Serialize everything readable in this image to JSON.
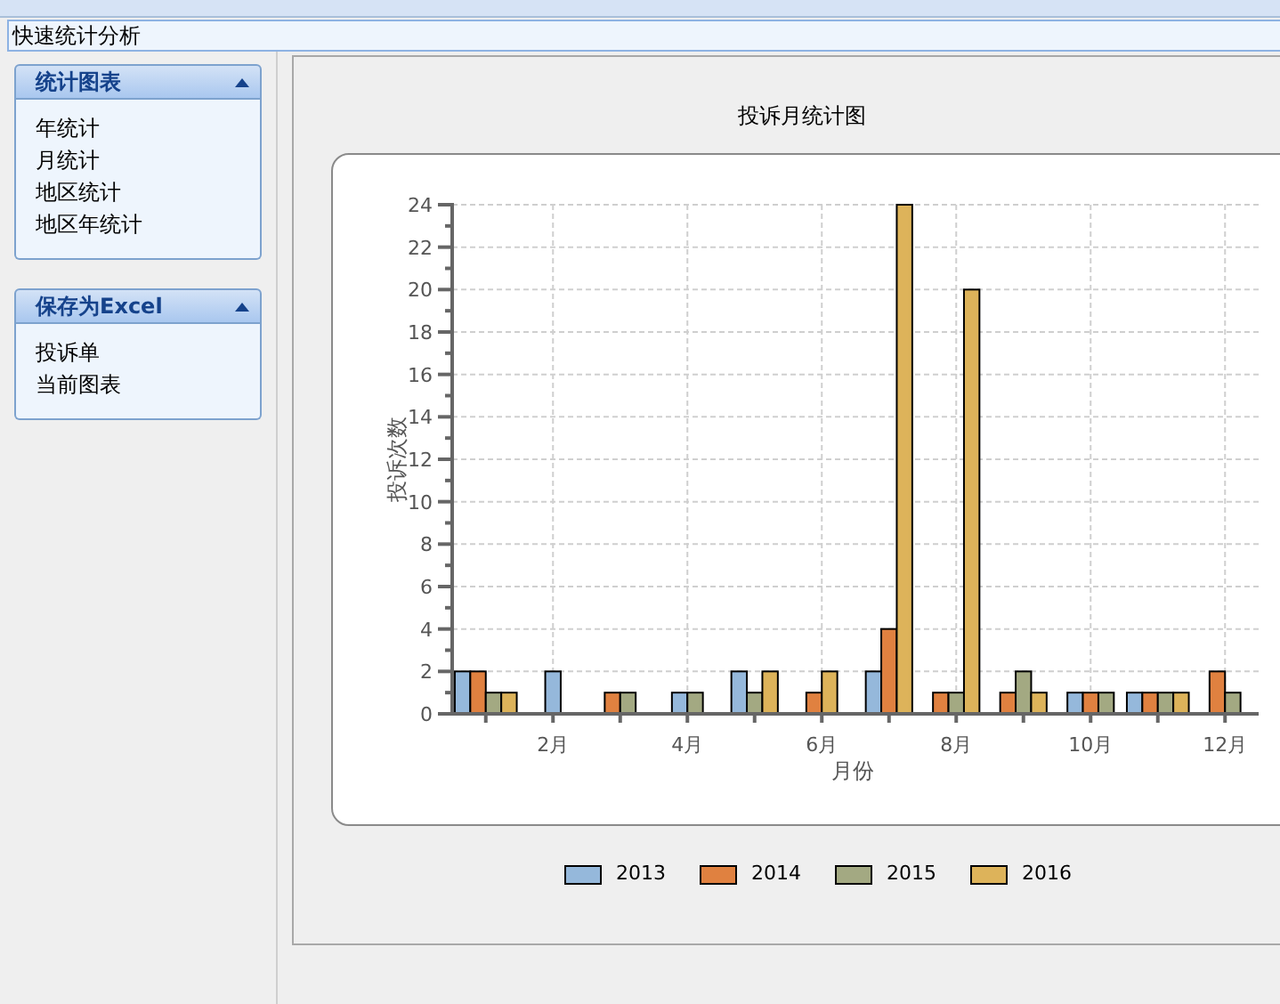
{
  "page_title": "快速统计分析",
  "sidebar": {
    "panels": [
      {
        "title": "统计图表",
        "expanded": true,
        "items": [
          "年统计",
          "月统计",
          "地区统计",
          "地区年统计"
        ]
      },
      {
        "title": "保存为Excel",
        "expanded": true,
        "items": [
          "投诉单",
          "当前图表"
        ]
      }
    ]
  },
  "chart": {
    "title": "投诉月统计图",
    "chart_data": {
      "type": "bar",
      "xlabel": "月份",
      "ylabel": "投诉次数",
      "x": [
        1,
        2,
        3,
        4,
        5,
        6,
        7,
        8,
        9,
        10,
        11,
        12
      ],
      "series": [
        {
          "name": "2013",
          "color": "#95b8db",
          "values": [
            2,
            2,
            null,
            1,
            2,
            null,
            2,
            null,
            null,
            1,
            1,
            null
          ]
        },
        {
          "name": "2014",
          "color": "#e08140",
          "values": [
            2,
            null,
            1,
            null,
            null,
            1,
            4,
            1,
            1,
            1,
            1,
            2
          ]
        },
        {
          "name": "2015",
          "color": "#a3a982",
          "values": [
            1,
            null,
            1,
            1,
            1,
            null,
            null,
            1,
            2,
            1,
            1,
            1
          ]
        },
        {
          "name": "2016",
          "color": "#ddb35a",
          "values": [
            1,
            null,
            null,
            null,
            2,
            2,
            24,
            20,
            1,
            null,
            1,
            null
          ]
        }
      ],
      "xlim": [
        0.5,
        12.5
      ],
      "ylim": [
        0,
        24
      ],
      "grid": true,
      "yticks": [
        0,
        2,
        4,
        6,
        8,
        10,
        12,
        14,
        16,
        18,
        20,
        22,
        24
      ],
      "xticks": [
        {
          "value": 2,
          "label": "2月"
        },
        {
          "value": 4,
          "label": "4月"
        },
        {
          "value": 6,
          "label": "6月"
        },
        {
          "value": 8,
          "label": "8月"
        },
        {
          "value": 10,
          "label": "10月"
        },
        {
          "value": 12,
          "label": "12月"
        }
      ]
    }
  }
}
